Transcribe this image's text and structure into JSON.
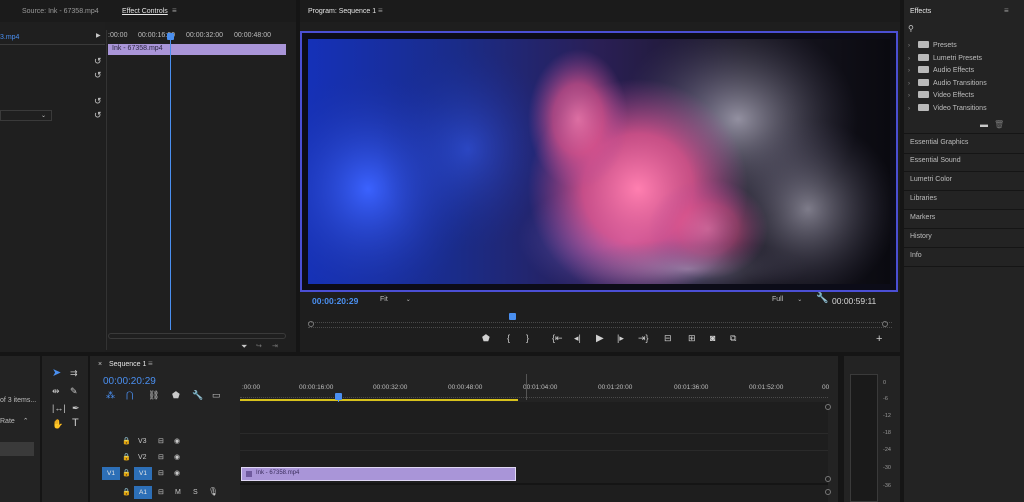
{
  "source_panel": {
    "tab_source": "Source: Ink - 67358.mp4",
    "tab_effect_controls": "Effect Controls",
    "clip_name_short": "3.mp4",
    "timecodes": [
      ":00:00",
      "00:00:16:00",
      "00:00:32:00",
      "00:00:48:00"
    ],
    "clip_bar_label": "Ink - 67358.mp4"
  },
  "program": {
    "title": "Program: Sequence 1",
    "timecode": "00:00:20:29",
    "fit_label": "Fit",
    "quality_label": "Full",
    "duration": "00:00:59:11"
  },
  "effects": {
    "title": "Effects",
    "items": [
      "Presets",
      "Lumetri Presets",
      "Audio Effects",
      "Audio Transitions",
      "Video Effects",
      "Video Transitions"
    ],
    "sections": [
      "Essential Graphics",
      "Essential Sound",
      "Lumetri Color",
      "Libraries",
      "Markers",
      "History",
      "Info"
    ]
  },
  "project_panel": {
    "items_text": "of 3 items...",
    "rate_label": "Rate"
  },
  "timeline": {
    "title": "Sequence 1",
    "timecode": "00:00:20:29",
    "ruler": [
      ":00:00",
      "00:00:16:00",
      "00:00:32:00",
      "00:00:48:00",
      "00:01:04:00",
      "00:01:20:00",
      "00:01:36:00",
      "00:01:52:00",
      "00"
    ],
    "tracks": [
      "V3",
      "V2",
      "V1",
      "A1"
    ],
    "source_patch": "V1",
    "audio_patch": "A1",
    "mute_label": "M",
    "solo_label": "S",
    "clip_label": "Ink - 67358.mp4"
  },
  "meter": {
    "labels": [
      "0",
      "-6",
      "-12",
      "-18",
      "-24",
      "-30",
      "-36"
    ]
  },
  "colors": {
    "accent": "#4a8ff0",
    "clip_purple": "#a995d8",
    "monitor_border": "#4b4fd4",
    "playbar_yellow": "#d8c21c"
  }
}
